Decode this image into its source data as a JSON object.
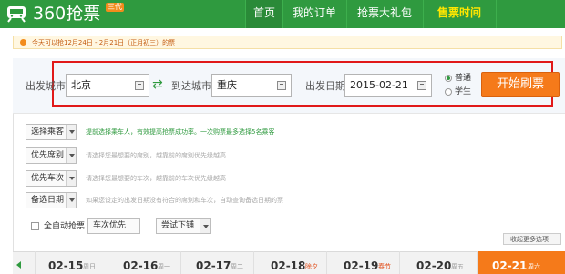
{
  "header": {
    "logo_text": "360抢票",
    "logo_badge": "三代",
    "nav": [
      {
        "label": "首页"
      },
      {
        "label": "我的订单"
      },
      {
        "label": "抢票大礼包"
      },
      {
        "label": "售票时间"
      }
    ]
  },
  "notice": {
    "text": "今天可以抢12月24日 - 2月21日（正月初三）的票"
  },
  "search": {
    "from_label": "出发城市",
    "from_value": "北京",
    "to_label": "到达城市",
    "to_value": "重庆",
    "date_label": "出发日期",
    "date_value": "2015-02-21",
    "ticket_types": [
      {
        "label": "普通",
        "selected": true
      },
      {
        "label": "学生",
        "selected": false
      }
    ],
    "start_button": "开始刷票"
  },
  "options": [
    {
      "button": "选择乘客",
      "hint": "提前选择乘车人，有效提高抢票成功率。一次购票最多选择5名乘客"
    },
    {
      "button": "优先席别",
      "hint": "请选择您最想要的席别，越靠前的席别优先级越高"
    },
    {
      "button": "优先车次",
      "hint": "请选择您最想要的车次，越靠前的车次优先级越高"
    },
    {
      "button": "备选日期",
      "hint": "如果您设定的出发日期没有符合的席别和车次，自动查询备选日期的票"
    }
  ],
  "auto": {
    "checkbox_label": "全自动抢票",
    "select1": "车次优先",
    "select2": "尝试下铺",
    "fold_link": "收起更多选项"
  },
  "dates": [
    {
      "date": "02-15",
      "weekday": "周日",
      "holiday": false,
      "active": false
    },
    {
      "date": "02-16",
      "weekday": "周一",
      "holiday": false,
      "active": false
    },
    {
      "date": "02-17",
      "weekday": "周二",
      "holiday": false,
      "active": false
    },
    {
      "date": "02-18",
      "weekday": "除夕",
      "holiday": true,
      "active": false
    },
    {
      "date": "02-19",
      "weekday": "春节",
      "holiday": true,
      "active": false
    },
    {
      "date": "02-20",
      "weekday": "周五",
      "holiday": false,
      "active": false
    },
    {
      "date": "02-21",
      "weekday": "周六",
      "holiday": false,
      "active": true
    }
  ],
  "colors": {
    "brand_green": "#2f9a3f",
    "accent_orange": "#f57a1a",
    "highlight_frame": "#e11919",
    "active_nav": "#ffe600"
  }
}
